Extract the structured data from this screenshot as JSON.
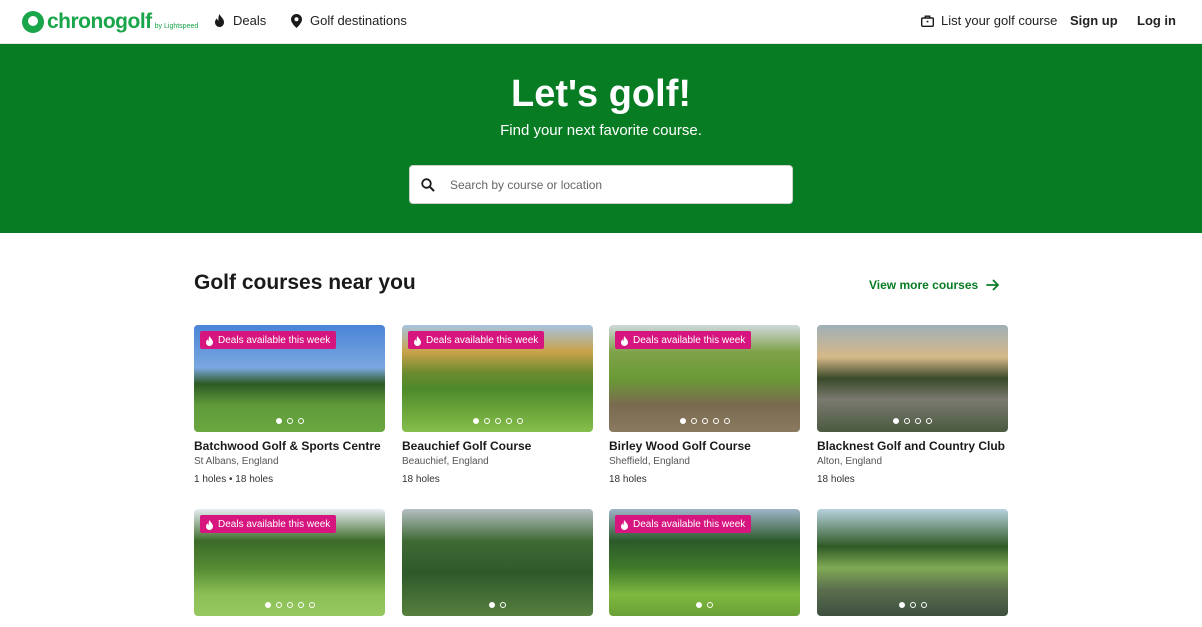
{
  "header": {
    "logo_text": "chronogolf",
    "logo_sub": "by Lightspeed",
    "nav": {
      "deals": "Deals",
      "destinations": "Golf destinations",
      "list_course": "List your golf course",
      "sign_up": "Sign up",
      "log_in": "Log in"
    }
  },
  "hero": {
    "title": "Let's golf!",
    "subtitle": "Find your next favorite course.",
    "search_placeholder": "Search by course or location"
  },
  "section": {
    "title": "Golf courses near you",
    "view_more": "View more courses"
  },
  "deal_badge": "Deals available this week",
  "colors": {
    "brand_green": "#087c23",
    "logo_green": "#19a54a",
    "deal_pink": "#d6157f"
  },
  "courses": [
    {
      "name": "Batchwood Golf & Sports Centre",
      "location": "St Albans, England",
      "holes": "1 holes • 18 holes",
      "deal": true,
      "photos": 3,
      "active_photo": 1
    },
    {
      "name": "Beauchief Golf Course",
      "location": "Beauchief, England",
      "holes": "18 holes",
      "deal": true,
      "photos": 5,
      "active_photo": 1
    },
    {
      "name": "Birley Wood Golf Course",
      "location": "Sheffield, England",
      "holes": "18 holes",
      "deal": true,
      "photos": 5,
      "active_photo": 1
    },
    {
      "name": "Blacknest Golf and Country Club",
      "location": "Alton, England",
      "holes": "18 holes",
      "deal": false,
      "photos": 4,
      "active_photo": 1
    },
    {
      "name": "",
      "location": "",
      "holes": "",
      "deal": true,
      "photos": 5,
      "active_photo": 1
    },
    {
      "name": "",
      "location": "",
      "holes": "",
      "deal": false,
      "photos": 2,
      "active_photo": 1
    },
    {
      "name": "",
      "location": "",
      "holes": "",
      "deal": true,
      "photos": 2,
      "active_photo": 1
    },
    {
      "name": "",
      "location": "",
      "holes": "",
      "deal": false,
      "photos": 3,
      "active_photo": 1
    }
  ]
}
